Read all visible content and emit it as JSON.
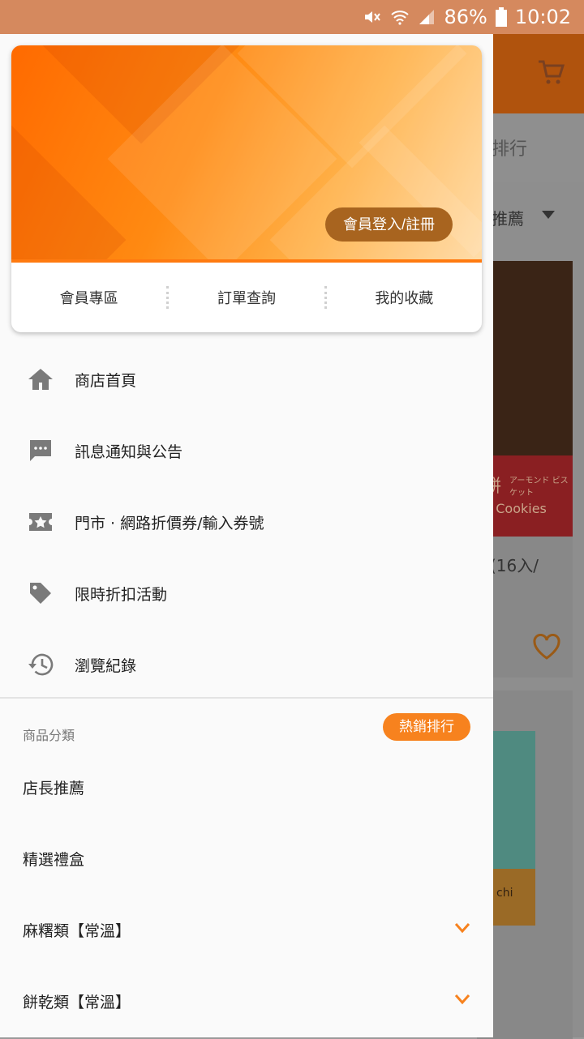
{
  "status_bar": {
    "battery": "86%",
    "time": "10:02"
  },
  "background_app": {
    "tab_partial": "排行",
    "sort_partial": "推薦",
    "product1_name_partial": "(16入/",
    "product1_banner_jp": "アーモンド ビスケット",
    "product1_banner_en": "d Cookies",
    "product1_banner_char": "餅",
    "product2_logo_partial": "chi"
  },
  "drawer": {
    "login_button": "會員登入/註冊",
    "card_tabs": [
      "會員專區",
      "訂單查詢",
      "我的收藏"
    ],
    "menu": [
      {
        "icon": "home-icon",
        "label": "商店首頁"
      },
      {
        "icon": "message-icon",
        "label": "訊息通知與公告"
      },
      {
        "icon": "coupon-icon",
        "label": "門市 · 網路折價券/輸入券號"
      },
      {
        "icon": "tag-icon",
        "label": "限時折扣活動"
      },
      {
        "icon": "history-icon",
        "label": "瀏覽紀錄"
      }
    ],
    "category_title": "商品分類",
    "hot_button": "熱銷排行",
    "categories": [
      {
        "label": "店長推薦",
        "expandable": false
      },
      {
        "label": "精選禮盒",
        "expandable": false
      },
      {
        "label": "麻糬類【常溫】",
        "expandable": true
      },
      {
        "label": "餅乾類【常溫】",
        "expandable": true
      }
    ]
  },
  "colors": {
    "accent": "#f7821e",
    "status_bar": "#d5895e",
    "login_button": "#a8641f"
  }
}
